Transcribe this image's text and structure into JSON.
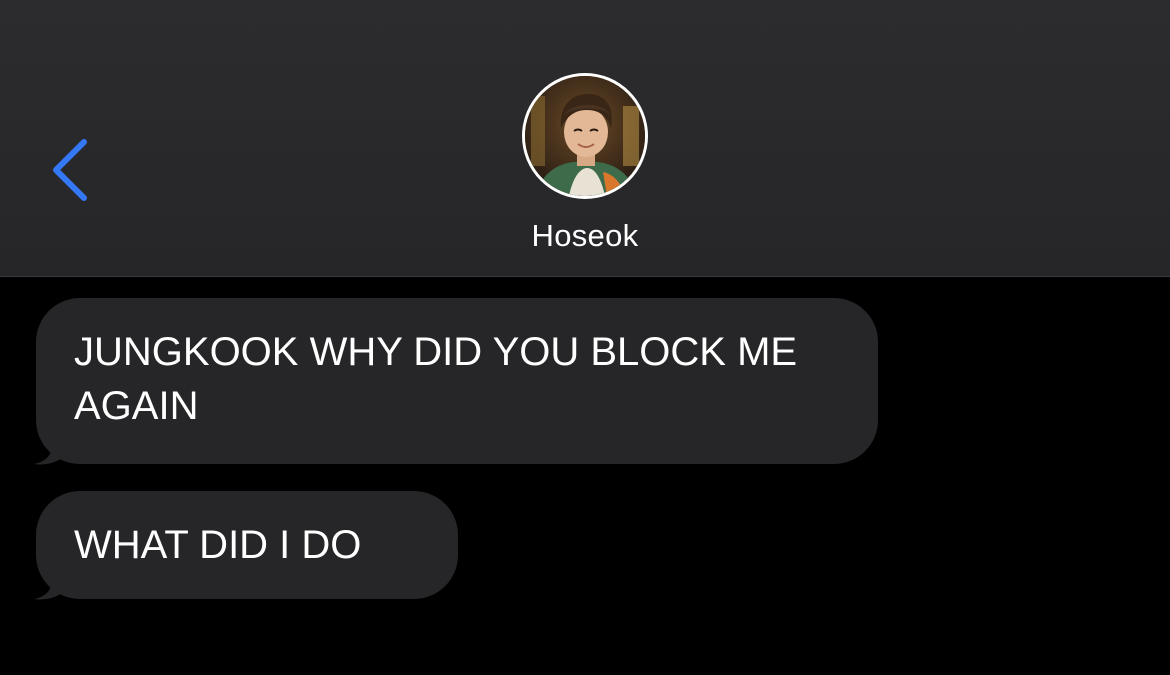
{
  "header": {
    "back_icon": "chevron-left-icon",
    "accent_color": "#3478f6",
    "contact": {
      "name": "Hoseok",
      "avatar_icon": "contact-photo"
    }
  },
  "messages": [
    {
      "direction": "incoming",
      "text": "JUNGKOOK WHY DID YOU BLOCK ME AGAIN"
    },
    {
      "direction": "incoming",
      "text": "WHAT DID I DO"
    }
  ],
  "colors": {
    "background": "#000000",
    "header_background": "#2c2c2e",
    "bubble_incoming": "#262628",
    "text": "#ffffff"
  }
}
